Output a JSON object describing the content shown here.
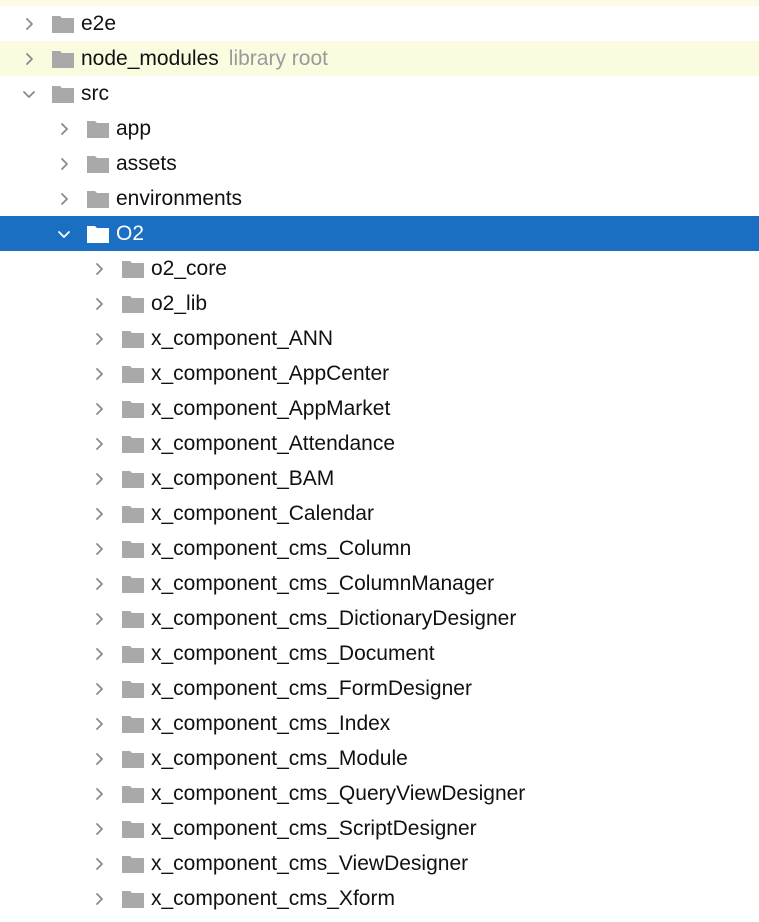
{
  "colors": {
    "folder": "#a9a9a9",
    "folder_selected": "#ffffff",
    "selection": "#1b6fc2",
    "library_bg": "#fbfbe0",
    "arrow": "#8a8a8a",
    "hint_text": "#9a9a9a"
  },
  "icons": {
    "collapsed": "chevron-right-icon",
    "expanded": "chevron-down-icon",
    "folder": "folder-icon"
  },
  "tree": {
    "items": [
      {
        "label": "e2e",
        "level": 0,
        "expanded": false
      },
      {
        "label": "node_modules",
        "hint": "library root",
        "level": 0,
        "expanded": false,
        "library": true
      },
      {
        "label": "src",
        "level": 0,
        "expanded": true
      },
      {
        "label": "app",
        "level": 1,
        "expanded": false
      },
      {
        "label": "assets",
        "level": 1,
        "expanded": false
      },
      {
        "label": "environments",
        "level": 1,
        "expanded": false
      },
      {
        "label": "O2",
        "level": 1,
        "expanded": true,
        "selected": true
      },
      {
        "label": "o2_core",
        "level": 2,
        "expanded": false
      },
      {
        "label": "o2_lib",
        "level": 2,
        "expanded": false
      },
      {
        "label": "x_component_ANN",
        "level": 2,
        "expanded": false
      },
      {
        "label": "x_component_AppCenter",
        "level": 2,
        "expanded": false
      },
      {
        "label": "x_component_AppMarket",
        "level": 2,
        "expanded": false
      },
      {
        "label": "x_component_Attendance",
        "level": 2,
        "expanded": false
      },
      {
        "label": "x_component_BAM",
        "level": 2,
        "expanded": false
      },
      {
        "label": "x_component_Calendar",
        "level": 2,
        "expanded": false
      },
      {
        "label": "x_component_cms_Column",
        "level": 2,
        "expanded": false
      },
      {
        "label": "x_component_cms_ColumnManager",
        "level": 2,
        "expanded": false
      },
      {
        "label": "x_component_cms_DictionaryDesigner",
        "level": 2,
        "expanded": false
      },
      {
        "label": "x_component_cms_Document",
        "level": 2,
        "expanded": false
      },
      {
        "label": "x_component_cms_FormDesigner",
        "level": 2,
        "expanded": false
      },
      {
        "label": "x_component_cms_Index",
        "level": 2,
        "expanded": false
      },
      {
        "label": "x_component_cms_Module",
        "level": 2,
        "expanded": false
      },
      {
        "label": "x_component_cms_QueryViewDesigner",
        "level": 2,
        "expanded": false
      },
      {
        "label": "x_component_cms_ScriptDesigner",
        "level": 2,
        "expanded": false
      },
      {
        "label": "x_component_cms_ViewDesigner",
        "level": 2,
        "expanded": false
      },
      {
        "label": "x_component_cms_Xform",
        "level": 2,
        "expanded": false
      }
    ]
  }
}
